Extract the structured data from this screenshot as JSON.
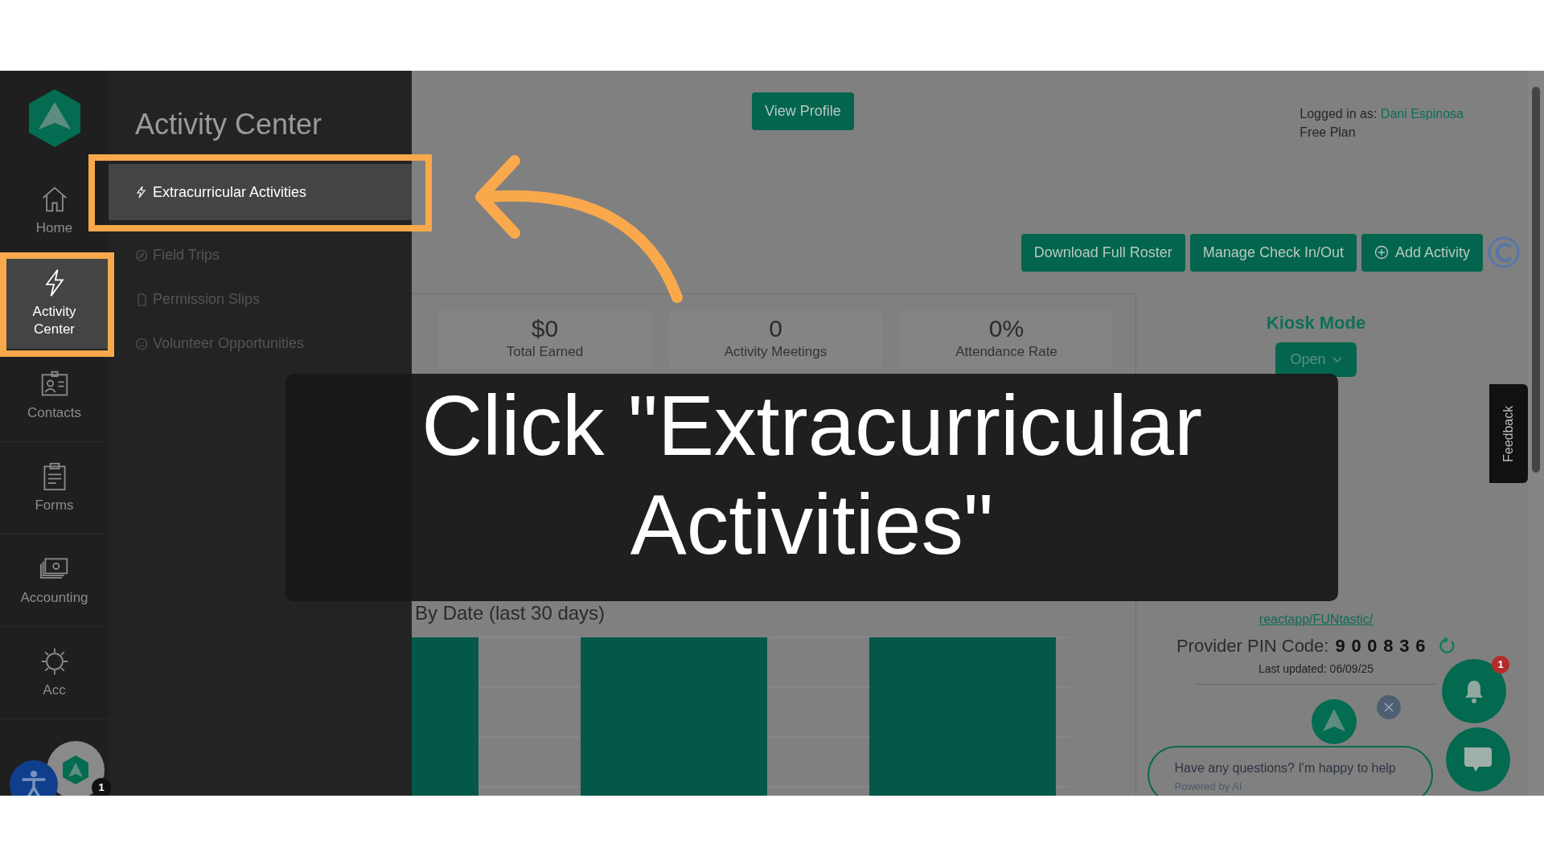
{
  "sidebar": {
    "items": [
      {
        "label": "Home",
        "selected": false
      },
      {
        "label": "Activity Center",
        "selected": true
      },
      {
        "label": "Contacts",
        "selected": false
      },
      {
        "label": "Forms",
        "selected": false
      },
      {
        "label": "Accounting",
        "selected": false
      },
      {
        "label": "Acc",
        "selected": false
      }
    ]
  },
  "submenu": {
    "title": "Activity Center",
    "items": [
      {
        "label": "Extracurricular Activities",
        "selected": true
      },
      {
        "label": "Field Trips",
        "selected": false
      },
      {
        "label": "Permission Slips",
        "selected": false
      },
      {
        "label": "Volunteer Opportunities",
        "selected": false
      }
    ]
  },
  "header": {
    "view_profile": "View Profile",
    "logged_in_label": "Logged in as:",
    "user": "Dani Espinosa",
    "plan": "Free Plan"
  },
  "actions": [
    "Download Full Roster",
    "Manage Check In/Out",
    "Add Activity"
  ],
  "stats": [
    {
      "value": "$0",
      "label": "Total Earned"
    },
    {
      "value": "0",
      "label": "Activity Meetings"
    },
    {
      "value": "0%",
      "label": "Attendance Rate"
    }
  ],
  "chart": {
    "title": "By Date (last 30 days)"
  },
  "kiosk": {
    "title": "Kiosk Mode",
    "button": "Open",
    "url": "reactapp/FUNtastic/",
    "pin_label": "Provider PIN Code:",
    "pin": "900836",
    "updated": "Last updated: 06/09/25"
  },
  "chat": {
    "message": "Have any questions? I'm happy to help",
    "powered": "Powered by AI",
    "notification_count": "1"
  },
  "helper_badge": "1",
  "feedback": "Feedback",
  "caption": "Click \"Extracurricular Activities\""
}
